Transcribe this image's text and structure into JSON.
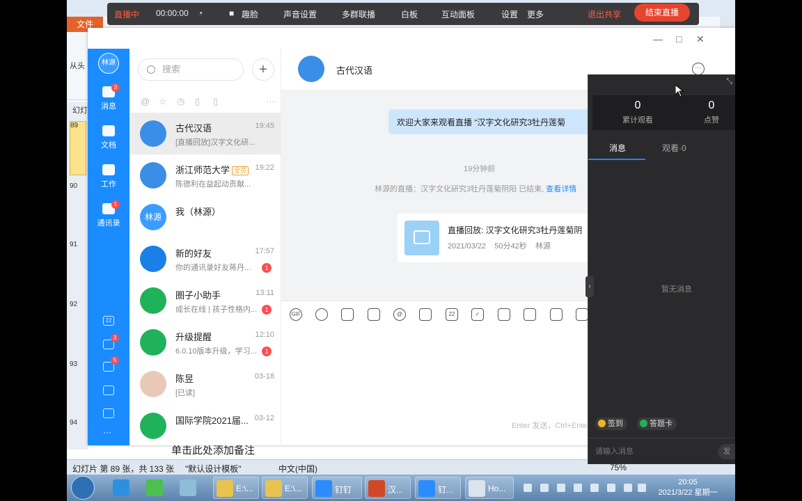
{
  "colors": {
    "brand_blue": "#1a8cff",
    "live_red": "#e5452e",
    "panel_dark": "#2a2a2c",
    "bubble_blue": "#cde6fb"
  },
  "ppt": {
    "file_tab": "文件",
    "ribbon_left": "从头",
    "slides_label": "幻灯",
    "thumbs": [
      "89",
      "90",
      "91",
      "92",
      "93",
      "94"
    ],
    "notes_text": "单击此处添加备注",
    "status": {
      "slide_info": "幻灯片 第 89 张，共 133 张",
      "theme": "\"默认设计模板\"",
      "language": "中文(中国)",
      "zoom": "75%"
    }
  },
  "livebar": {
    "status": "直播中",
    "timer": "00:00:00",
    "beauty": "趣脸",
    "audio": "声音设置",
    "multi": "多群联播",
    "whiteboard": "白板",
    "interact": "互动面板",
    "settings": "设置",
    "more": "更多",
    "exit_share": "退出共享",
    "end_live": "结束直播"
  },
  "nav": {
    "me": "林源",
    "items": [
      {
        "label": "消息",
        "icon": "chat-icon",
        "badge": "3"
      },
      {
        "label": "文档",
        "icon": "doc-icon",
        "badge": ""
      },
      {
        "label": "工作",
        "icon": "grid-icon",
        "badge": ""
      },
      {
        "label": "通讯录",
        "icon": "contacts-icon",
        "badge": "1"
      }
    ],
    "bottom": [
      {
        "icon": "calendar-icon",
        "text": "22",
        "badge": ""
      },
      {
        "icon": "todo-icon",
        "text": "",
        "badge": "3"
      },
      {
        "icon": "ding-icon",
        "text": "",
        "badge": "5"
      },
      {
        "icon": "phone-icon",
        "text": "",
        "badge": ""
      },
      {
        "icon": "mail-icon",
        "text": "",
        "badge": ""
      },
      {
        "icon": "more-icon",
        "text": "···",
        "badge": ""
      }
    ]
  },
  "search": {
    "placeholder": "搜索"
  },
  "conversations": [
    {
      "name": "古代汉语",
      "time": "19:45",
      "msg": "[直播回放]汉字文化研...",
      "badge": "",
      "color": "#3a8ee6",
      "avatar": "",
      "active": true
    },
    {
      "name": "浙江师范大学",
      "tag": "全员",
      "time": "19:22",
      "msg": "陈德利在益起动贡献...",
      "badge": "",
      "color": "#3a8ee6",
      "avatar": ""
    },
    {
      "name": "我（林源）",
      "time": "",
      "msg": "",
      "badge": "",
      "color": "#3a9cff",
      "avatar": "林源"
    },
    {
      "name": "新的好友",
      "time": "17:57",
      "msg": "你的通讯录好友蒋丹...",
      "badge": "1",
      "color": "#1a7fe8",
      "avatar": ""
    },
    {
      "name": "圈子小助手",
      "time": "13:11",
      "msg": "成长在线 | 孩子性格内...",
      "badge": "1",
      "color": "#20b25a",
      "avatar": ""
    },
    {
      "name": "升级提醒",
      "time": "12:10",
      "msg": "6.0.10版本升级，学习...",
      "badge": "1",
      "color": "#20b25a",
      "avatar": ""
    },
    {
      "name": "陈昱",
      "time": "03-18",
      "msg": "[已读]",
      "badge": "",
      "color": "#e8c9b8",
      "avatar": ""
    },
    {
      "name": "国际学院2021届...",
      "time": "03-12",
      "msg": "",
      "badge": "",
      "color": "#20b25a",
      "avatar": ""
    }
  ],
  "chat": {
    "title": "古代汉语",
    "bubble": "欢迎大家来观看直播 “汉字文化研究3牡丹莲菊",
    "time": "19分钟前",
    "sys_msg": "林源的直播：汉字文化研究3牡丹莲菊阴阳 已结束,",
    "sys_link": "查看详情",
    "card_title": "直播回放: 汉字文化研究3牡丹莲菊阴",
    "card_date": "2021/03/22",
    "card_duration": "50分42秒",
    "card_author": "林源",
    "send_hint": "Enter 发送，Ctrl+Enter"
  },
  "live_panel": {
    "total_views": "0",
    "total_views_label": "累计观看",
    "likes": "0",
    "likes_label": "点赞",
    "tab_messages": "消息",
    "tab_viewers": "观看·0",
    "empty": "暂无消息",
    "checkin": "签到",
    "quiz": "答题卡",
    "input_placeholder": "请输入消息",
    "send": "发"
  },
  "taskbar": {
    "apps": [
      {
        "label": "E:\\...",
        "icon": "folder-icon"
      },
      {
        "label": "E:\\...",
        "icon": "folder-icon"
      },
      {
        "label": "钉钉",
        "icon": "dingtalk-icon"
      },
      {
        "label": "汉...",
        "icon": "powerpoint-icon"
      },
      {
        "label": "钉...",
        "icon": "live-icon"
      },
      {
        "label": "Ho...",
        "icon": "window-icon"
      }
    ],
    "time": "20:05",
    "date": "2021/3/22 星期一"
  }
}
